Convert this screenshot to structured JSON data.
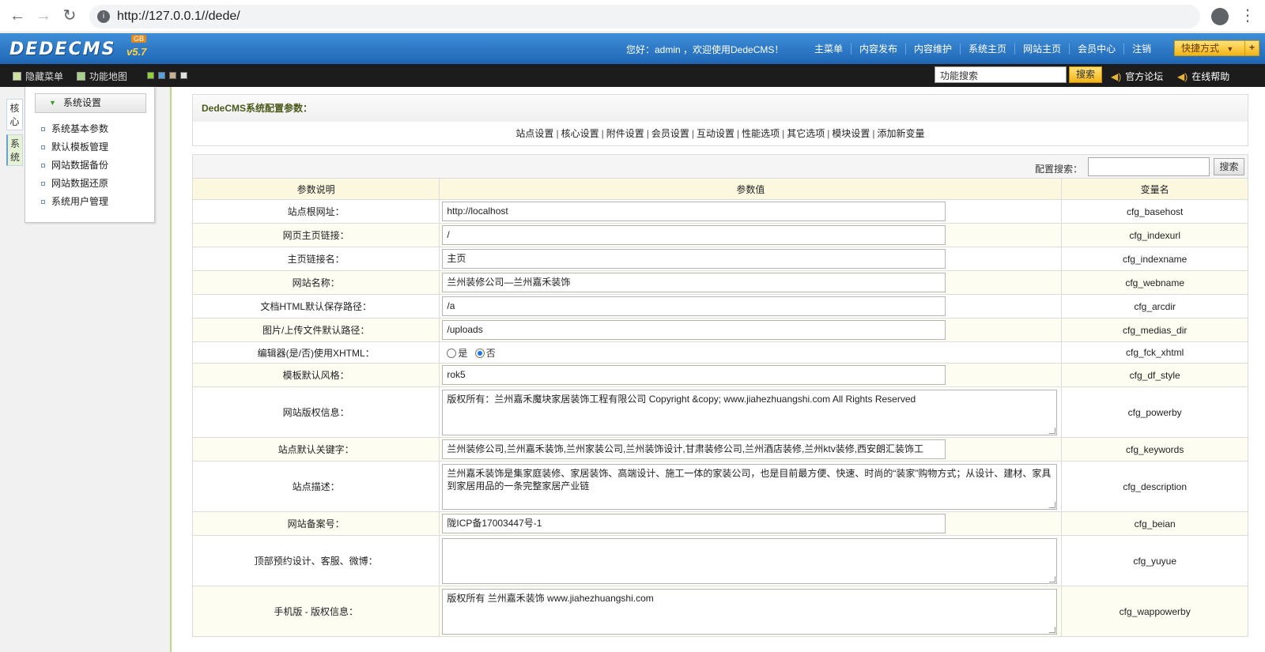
{
  "browser": {
    "url": "http://127.0.0.1//dede/"
  },
  "header": {
    "logo": "DEDECMS",
    "version": "v5.7",
    "badge": "GB",
    "welcome": "您好：admin ，欢迎使用DedeCMS！",
    "nav": [
      "主菜单",
      "内容发布",
      "内容维护",
      "系统主页",
      "网站主页",
      "会员中心",
      "注销"
    ],
    "quick_label": "快捷方式",
    "quick_plus": "+"
  },
  "toolbar": {
    "hide_menu": "隐藏菜单",
    "function_map": "功能地图",
    "search_value": "功能搜索",
    "search_button": "搜索",
    "forum": "官方论坛",
    "help": "在线帮助"
  },
  "sidebar": {
    "vtabs": [
      "核心",
      "系统"
    ],
    "section_title": "系统设置",
    "items": [
      "系统基本参数",
      "默认模板管理",
      "网站数据备份",
      "网站数据还原",
      "系统用户管理"
    ]
  },
  "main": {
    "title": "DedeCMS系统配置参数：",
    "tabs": [
      "站点设置",
      "核心设置",
      "附件设置",
      "会员设置",
      "互动设置",
      "性能选项",
      "其它选项",
      "模块设置",
      "添加新变量"
    ],
    "config_search_label": "配置搜索：",
    "config_search_button": "搜索",
    "columns": [
      "参数说明",
      "参数值",
      "变量名"
    ],
    "rows": [
      {
        "label": "站点根网址：",
        "value": "http://localhost",
        "var": "cfg_basehost"
      },
      {
        "label": "网页主页链接：",
        "value": "/",
        "var": "cfg_indexurl"
      },
      {
        "label": "主页链接名：",
        "value": "主页",
        "var": "cfg_indexname"
      },
      {
        "label": "网站名称：",
        "value": "兰州装修公司—兰州嘉禾装饰",
        "var": "cfg_webname"
      },
      {
        "label": "文档HTML默认保存路径：",
        "value": "/a",
        "var": "cfg_arcdir"
      },
      {
        "label": "图片/上传文件默认路径：",
        "value": "/uploads",
        "var": "cfg_medias_dir"
      },
      {
        "label": "编辑器(是/否)使用XHTML：",
        "radio_yes": "是",
        "radio_no": "否",
        "selected": "否",
        "var": "cfg_fck_xhtml"
      },
      {
        "label": "模板默认风格：",
        "value": "rok5",
        "var": "cfg_df_style"
      },
      {
        "label": "网站版权信息：",
        "value": "版权所有：兰州嘉禾魔块家居装饰工程有限公司 Copyright &copy;  www.jiahezhuangshi.com All Rights Reserved",
        "var": "cfg_powerby"
      },
      {
        "label": "站点默认关键字：",
        "value": "兰州装修公司,兰州嘉禾装饰,兰州家装公司,兰州装饰设计,甘肃装修公司,兰州酒店装修,兰州ktv装修,西安朗汇装饰工",
        "var": "cfg_keywords"
      },
      {
        "label": "站点描述：",
        "value": "兰州嘉禾装饰是集家庭装修、家居装饰、高端设计、施工一体的家装公司，也是目前最方便、快速、时尚的“装家”购物方式；从设计、建材、家具到家居用品的一条完整家居产业链",
        "var": "cfg_description"
      },
      {
        "label": "网站备案号：",
        "value": "陇ICP备17003447号-1",
        "var": "cfg_beian"
      },
      {
        "label": "顶部预约设计、客服、微博：",
        "value": "",
        "var": "cfg_yuyue"
      },
      {
        "label": "手机版 - 版权信息：",
        "value": "版权所有 兰州嘉禾装饰 www.jiahezhuangshi.com",
        "var": "cfg_wappowerby"
      }
    ]
  }
}
